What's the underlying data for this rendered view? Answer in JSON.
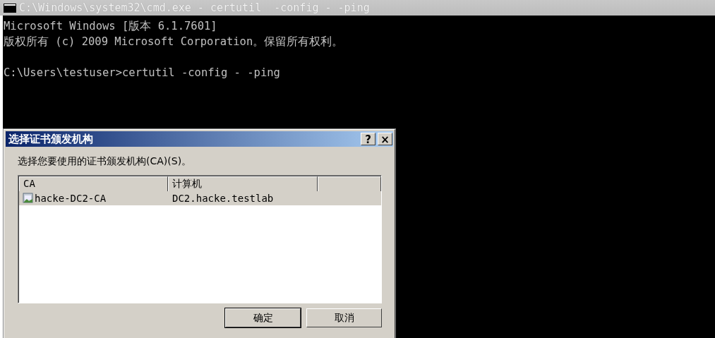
{
  "console": {
    "title": "C:\\Windows\\system32\\cmd.exe - certutil  -config - -ping",
    "lines": [
      "Microsoft Windows [版本 6.1.7601]",
      "版权所有 (c) 2009 Microsoft Corporation。保留所有权利。"
    ],
    "command_line": "C:\\Users\\testuser>certutil -config - -ping"
  },
  "dialog": {
    "title": "选择证书颁发机构",
    "title_buttons": [
      "?",
      "×"
    ],
    "prompt": "选择您要使用的证书颁发机构(CA)(S)。",
    "table": {
      "columns": [
        "CA",
        "计算机"
      ],
      "rows": [
        {
          "cells": [
            "hacke-DC2-CA",
            "DC2.hacke.testlab"
          ],
          "selected": true
        }
      ]
    },
    "buttons": [
      {
        "label": "确定",
        "default": true
      },
      {
        "label": "取消",
        "default": false
      }
    ]
  }
}
